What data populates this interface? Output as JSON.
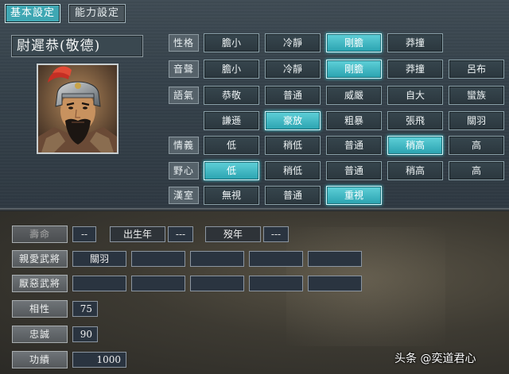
{
  "tabs": [
    {
      "label": "基本設定",
      "active": true
    },
    {
      "label": "能力設定",
      "active": false
    }
  ],
  "officer_name": "尉遲恭(敬德)",
  "attribute_rows": [
    {
      "label": "性格",
      "options": [
        "膽小",
        "冷靜",
        "剛膽",
        "莽撞"
      ],
      "selected": 2
    },
    {
      "label": "音聲",
      "options": [
        "膽小",
        "冷靜",
        "剛膽",
        "莽撞",
        "呂布"
      ],
      "selected": 2
    },
    {
      "label": "語氣",
      "options": [
        "恭敬",
        "普通",
        "威嚴",
        "自大",
        "蠻族"
      ],
      "selected": -1
    },
    {
      "label": "",
      "options": [
        "謙遜",
        "豪放",
        "粗暴",
        "張飛",
        "關羽"
      ],
      "selected": 1
    },
    {
      "label": "情義",
      "options": [
        "低",
        "稍低",
        "普通",
        "稍高",
        "高"
      ],
      "selected": 3
    },
    {
      "label": "野心",
      "options": [
        "低",
        "稍低",
        "普通",
        "稍高",
        "高"
      ],
      "selected": 0
    },
    {
      "label": "漢室",
      "options": [
        "無視",
        "普通",
        "重視"
      ],
      "selected": 2
    }
  ],
  "lifespan": {
    "label": "壽命",
    "value": "--",
    "birth_label": "出生年",
    "birth_value": "---",
    "death_label": "歿年",
    "death_value": "---"
  },
  "liked_officers": {
    "label": "親愛武將",
    "slots": [
      "關羽",
      "",
      "",
      "",
      ""
    ]
  },
  "disliked_officers": {
    "label": "厭惡武將",
    "slots": [
      "",
      "",
      "",
      "",
      ""
    ]
  },
  "stats": [
    {
      "label": "相性",
      "value": "75"
    },
    {
      "label": "忠誠",
      "value": "90"
    },
    {
      "label": "功績",
      "value": "1000"
    }
  ],
  "watermark": "头条 @奕道君心",
  "colors": {
    "selected": "#2aa3b0",
    "option_bg": "#2b373e",
    "panel_top": "#35414a",
    "panel_bottom": "#3d3a32"
  }
}
